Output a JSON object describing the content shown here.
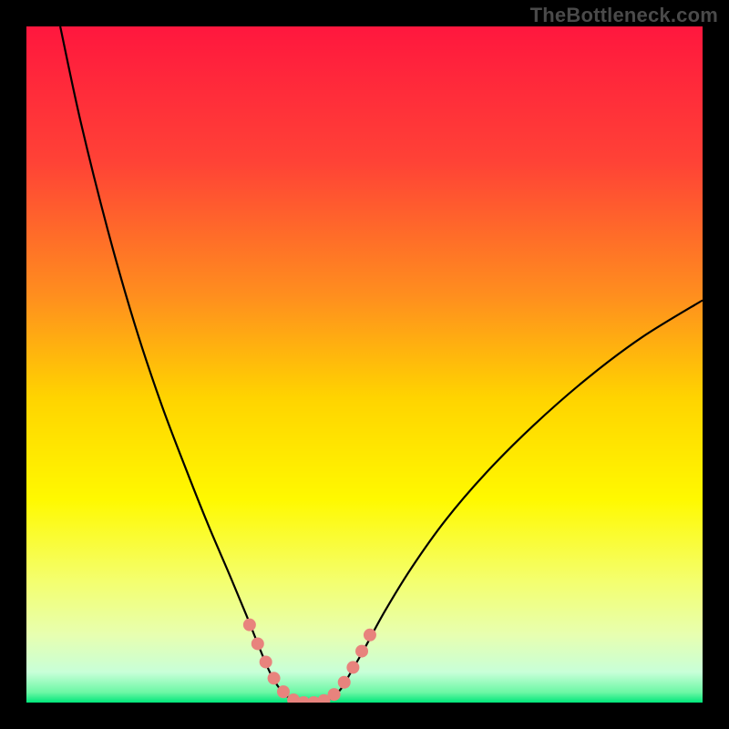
{
  "watermark": "TheBottleneck.com",
  "chart_data": {
    "type": "line",
    "title": "",
    "xlabel": "",
    "ylabel": "",
    "xlim": [
      0,
      100
    ],
    "ylim": [
      0,
      100
    ],
    "background_gradient": {
      "stops": [
        {
          "offset": 0.0,
          "color": "#ff173e"
        },
        {
          "offset": 0.2,
          "color": "#ff4236"
        },
        {
          "offset": 0.4,
          "color": "#ff8f1e"
        },
        {
          "offset": 0.55,
          "color": "#ffd400"
        },
        {
          "offset": 0.7,
          "color": "#fff900"
        },
        {
          "offset": 0.82,
          "color": "#f4ff6e"
        },
        {
          "offset": 0.9,
          "color": "#e7ffb0"
        },
        {
          "offset": 0.955,
          "color": "#c8ffd8"
        },
        {
          "offset": 0.985,
          "color": "#6cf7a5"
        },
        {
          "offset": 1.0,
          "color": "#00e67a"
        }
      ]
    },
    "series": [
      {
        "name": "bottleneck-curve",
        "type": "line",
        "color": "#000000",
        "width": 2.2,
        "points": [
          {
            "x": 5.0,
            "y": 100.0
          },
          {
            "x": 8.0,
            "y": 86.0
          },
          {
            "x": 12.0,
            "y": 70.0
          },
          {
            "x": 16.0,
            "y": 56.0
          },
          {
            "x": 20.0,
            "y": 44.0
          },
          {
            "x": 24.0,
            "y": 33.5
          },
          {
            "x": 27.0,
            "y": 26.0
          },
          {
            "x": 30.0,
            "y": 19.0
          },
          {
            "x": 32.5,
            "y": 13.0
          },
          {
            "x": 34.5,
            "y": 8.0
          },
          {
            "x": 36.0,
            "y": 4.5
          },
          {
            "x": 37.5,
            "y": 2.0
          },
          {
            "x": 39.0,
            "y": 0.6
          },
          {
            "x": 41.0,
            "y": 0.0
          },
          {
            "x": 43.0,
            "y": 0.0
          },
          {
            "x": 45.0,
            "y": 0.6
          },
          {
            "x": 46.5,
            "y": 2.0
          },
          {
            "x": 48.0,
            "y": 4.5
          },
          {
            "x": 50.0,
            "y": 8.0
          },
          {
            "x": 53.0,
            "y": 13.5
          },
          {
            "x": 57.0,
            "y": 20.0
          },
          {
            "x": 62.0,
            "y": 27.0
          },
          {
            "x": 68.0,
            "y": 34.0
          },
          {
            "x": 75.0,
            "y": 41.0
          },
          {
            "x": 83.0,
            "y": 48.0
          },
          {
            "x": 91.0,
            "y": 54.0
          },
          {
            "x": 100.0,
            "y": 59.5
          }
        ]
      }
    ],
    "markers": {
      "color": "#e8837d",
      "radius": 7,
      "points": [
        {
          "x": 33.0,
          "y": 11.5
        },
        {
          "x": 34.2,
          "y": 8.7
        },
        {
          "x": 35.4,
          "y": 6.0
        },
        {
          "x": 36.6,
          "y": 3.6
        },
        {
          "x": 38.0,
          "y": 1.6
        },
        {
          "x": 39.5,
          "y": 0.4
        },
        {
          "x": 41.0,
          "y": 0.0
        },
        {
          "x": 42.5,
          "y": 0.0
        },
        {
          "x": 44.0,
          "y": 0.3
        },
        {
          "x": 45.5,
          "y": 1.2
        },
        {
          "x": 47.0,
          "y": 3.0
        },
        {
          "x": 48.3,
          "y": 5.2
        },
        {
          "x": 49.6,
          "y": 7.6
        },
        {
          "x": 50.8,
          "y": 10.0
        }
      ]
    }
  }
}
